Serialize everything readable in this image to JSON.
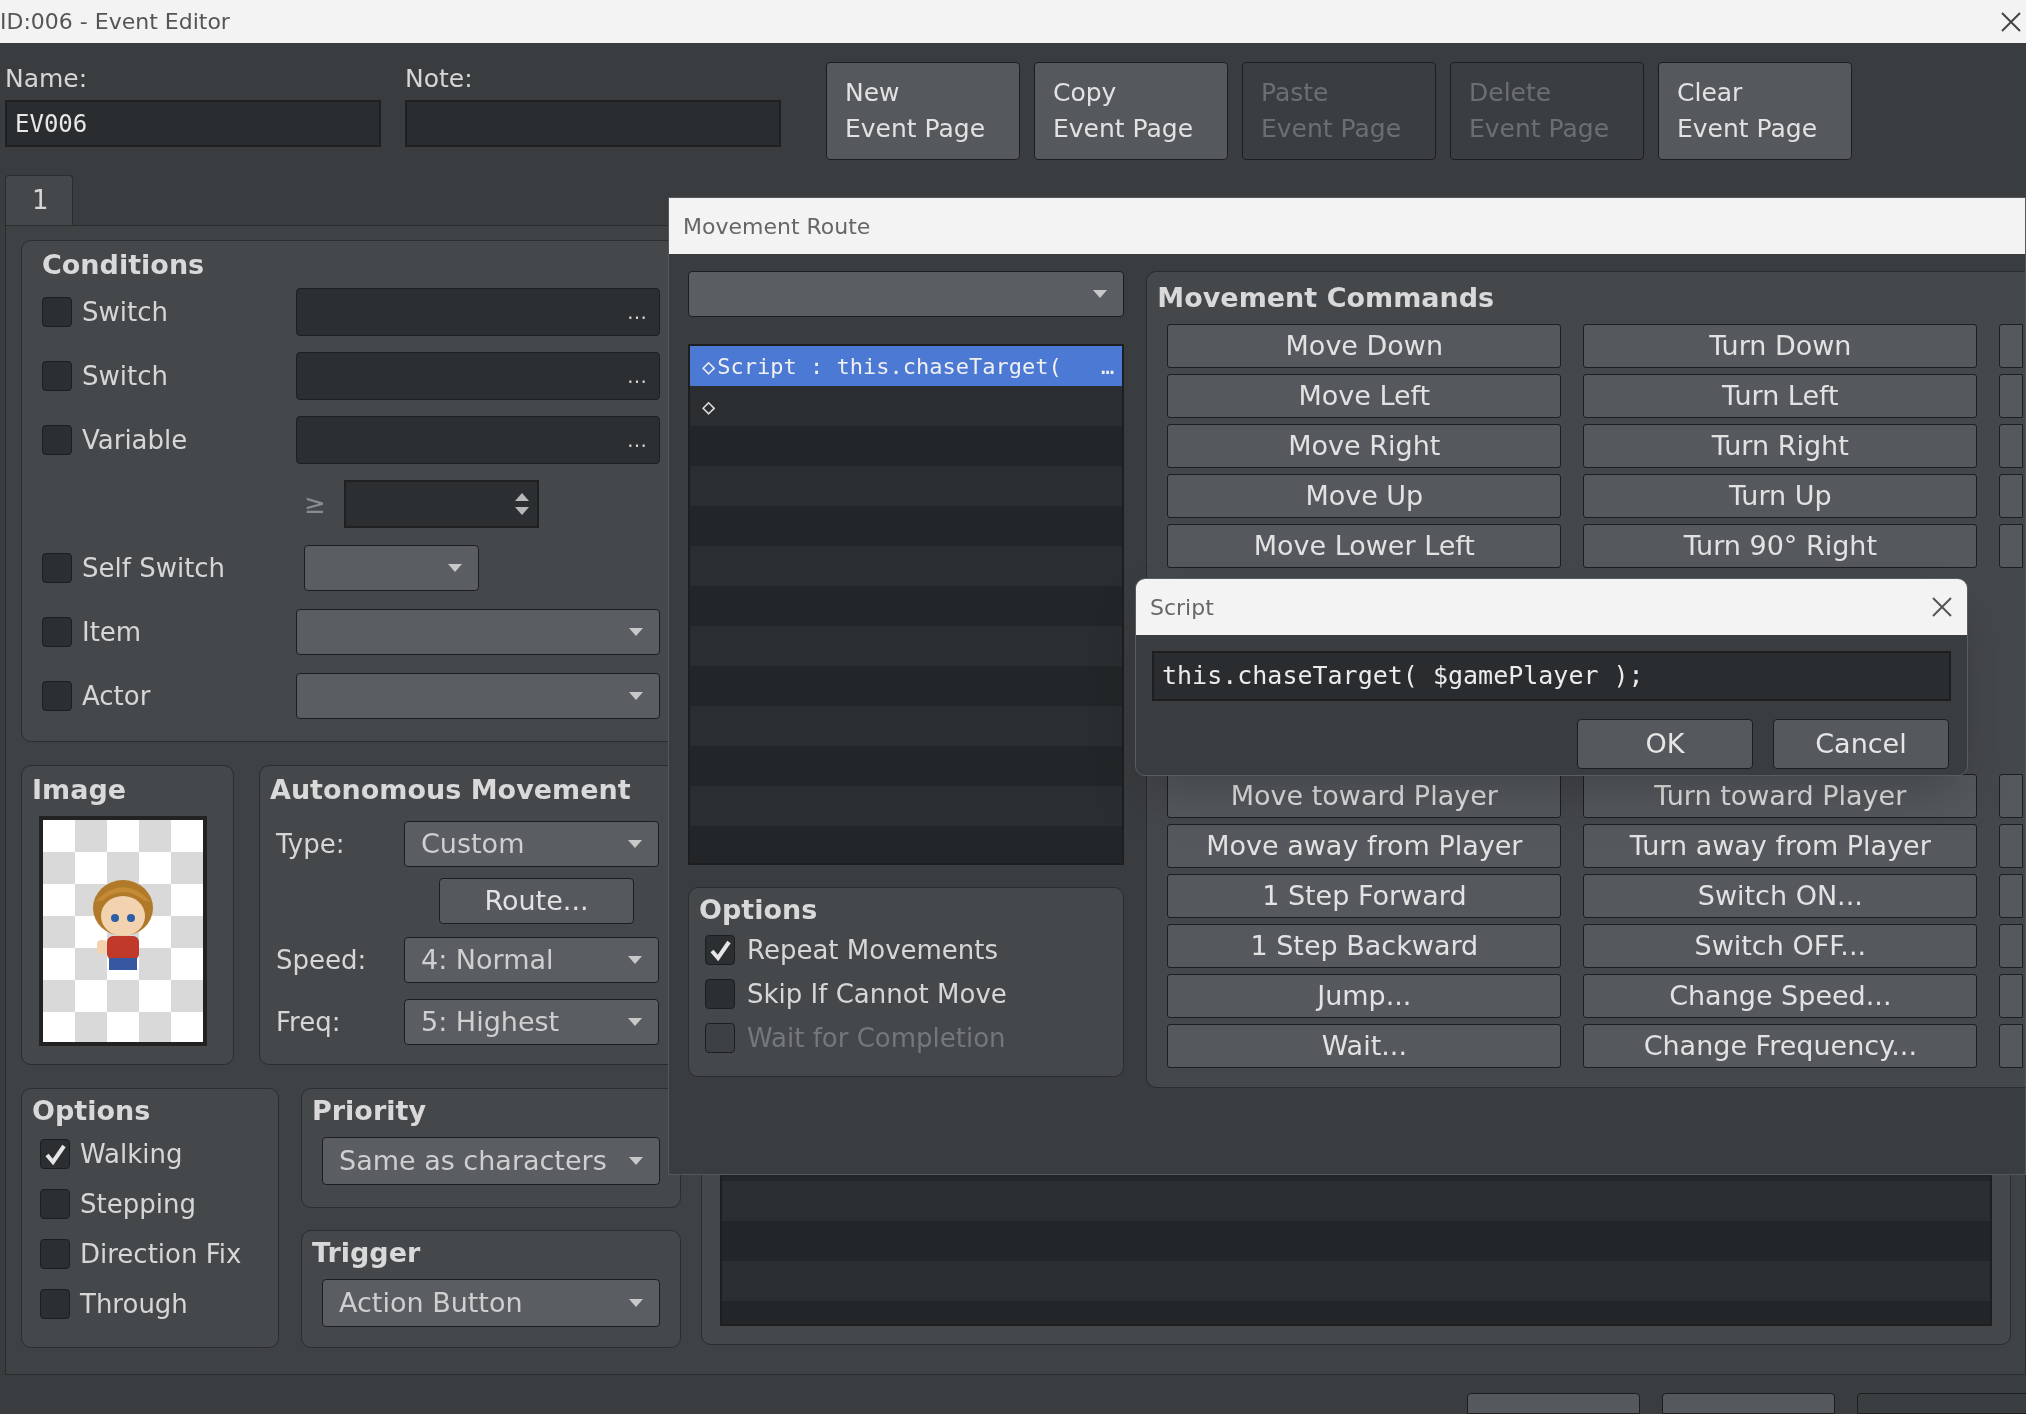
{
  "window": {
    "title": "ID:006 - Event Editor"
  },
  "name": {
    "label": "Name:",
    "value": "EV006"
  },
  "note": {
    "label": "Note:"
  },
  "page_buttons": [
    {
      "label": "New\nEvent Page",
      "disabled": false
    },
    {
      "label": "Copy\nEvent Page",
      "disabled": false
    },
    {
      "label": "Paste\nEvent Page",
      "disabled": true
    },
    {
      "label": "Delete\nEvent Page",
      "disabled": true
    },
    {
      "label": "Clear\nEvent Page",
      "disabled": false
    }
  ],
  "tabs": [
    {
      "label": "1",
      "selected": true
    }
  ],
  "conditions": {
    "title": "Conditions",
    "rows": [
      {
        "kind": "picker",
        "label": "Switch",
        "checked": false,
        "button": "…"
      },
      {
        "kind": "picker",
        "label": "Switch",
        "checked": false,
        "button": "…"
      },
      {
        "kind": "picker",
        "label": "Variable",
        "checked": false,
        "button": "…"
      },
      {
        "kind": "compare",
        "symbol": "≥"
      },
      {
        "kind": "short-dropdown",
        "label": "Self Switch",
        "checked": false
      },
      {
        "kind": "dropdown",
        "label": "Item",
        "checked": false
      },
      {
        "kind": "dropdown",
        "label": "Actor",
        "checked": false
      }
    ]
  },
  "image": {
    "title": "Image"
  },
  "autonomous_movement": {
    "title": "Autonomous Movement",
    "type": {
      "label": "Type:",
      "value": "Custom"
    },
    "route_button": "Route...",
    "speed": {
      "label": "Speed:",
      "value": "4: Normal"
    },
    "freq": {
      "label": "Freq:",
      "value": "5: Highest"
    }
  },
  "options": {
    "title": "Options",
    "items": [
      {
        "label": "Walking",
        "checked": true
      },
      {
        "label": "Stepping",
        "checked": false
      },
      {
        "label": "Direction Fix",
        "checked": false
      },
      {
        "label": "Through",
        "checked": false
      }
    ]
  },
  "priority": {
    "title": "Priority",
    "value": "Same as characters"
  },
  "trigger": {
    "title": "Trigger",
    "value": "Action Button"
  },
  "footer_buttons": [
    {
      "disabled": false
    },
    {
      "disabled": false
    },
    {
      "disabled": true
    }
  ],
  "movement_route": {
    "title": "Movement Route",
    "list": [
      {
        "marker": "◇",
        "text": "Script : this.chaseTarget(",
        "more": "…",
        "selected": true
      },
      {
        "marker": "◇",
        "selected": false
      }
    ],
    "options": {
      "title": "Options",
      "items": [
        {
          "label": "Repeat Movements",
          "checked": true,
          "disabled": false
        },
        {
          "label": "Skip If Cannot Move",
          "checked": false,
          "disabled": false
        },
        {
          "label": "Wait for Completion",
          "checked": false,
          "disabled": true
        }
      ]
    },
    "commands_title": "Movement Commands",
    "commands_top": [
      {
        "left": "Move Down",
        "right": "Turn Down"
      },
      {
        "left": "Move Left",
        "right": "Turn Left"
      },
      {
        "left": "Move Right",
        "right": "Turn Right"
      },
      {
        "left": "Move Up",
        "right": "Turn Up"
      },
      {
        "left": "Move Lower Left",
        "right": "Turn 90° Right"
      }
    ],
    "commands_bottom": [
      {
        "left": "Move toward Player",
        "right": "Turn toward Player"
      },
      {
        "left": "Move away from Player",
        "right": "Turn away from Player"
      },
      {
        "left": "1 Step Forward",
        "right": "Switch ON..."
      },
      {
        "left": "1 Step Backward",
        "right": "Switch OFF..."
      },
      {
        "left": "Jump...",
        "right": "Change Speed..."
      },
      {
        "left": "Wait...",
        "right": "Change Frequency..."
      }
    ]
  },
  "script_dialog": {
    "title": "Script",
    "value": "this.chaseTarget( $gamePlayer );",
    "buttons": [
      "OK",
      "Cancel"
    ]
  }
}
